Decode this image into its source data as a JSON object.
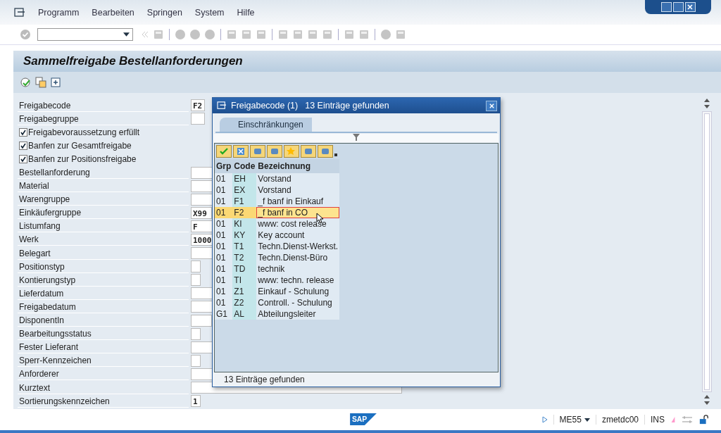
{
  "menu": [
    "Programm",
    "Bearbeiten",
    "Springen",
    "System",
    "Hilfe"
  ],
  "title": "Sammelfreigabe Bestellanforderungen",
  "form": [
    {
      "kind": "field",
      "label": "Freigabecode",
      "value": "F2"
    },
    {
      "kind": "field",
      "label": "Freigabegruppe"
    },
    {
      "kind": "checkbox",
      "label": "Freigabevoraussetzung erfüllt",
      "checked": true
    },
    {
      "kind": "checkbox",
      "label": "Banfen zur Gesamtfreigabe",
      "checked": true
    },
    {
      "kind": "checkbox",
      "label": "Banfen zur Positionsfreigabe",
      "checked": true
    },
    {
      "kind": "field",
      "label": "Bestellanforderung"
    },
    {
      "kind": "field",
      "label": "Material"
    },
    {
      "kind": "field",
      "label": "Warengruppe"
    },
    {
      "kind": "field",
      "label": "Einkäufergruppe",
      "value": "X99"
    },
    {
      "kind": "field",
      "label": "Listumfang",
      "value": "F"
    },
    {
      "kind": "field",
      "label": "Werk",
      "value": "1000"
    },
    {
      "kind": "field",
      "label": "Belegart"
    },
    {
      "kind": "field",
      "label": "Positionstyp"
    },
    {
      "kind": "field",
      "label": "Kontierungstyp"
    },
    {
      "kind": "field",
      "label": "Lieferdatum"
    },
    {
      "kind": "field",
      "label": "Freigabedatum"
    },
    {
      "kind": "field",
      "label": "DisponentIn"
    },
    {
      "kind": "field",
      "label": "Bearbeitungsstatus"
    },
    {
      "kind": "field",
      "label": "Fester Lieferant"
    },
    {
      "kind": "field",
      "label": "Sperr-Kennzeichen"
    },
    {
      "kind": "field",
      "label": "Anforderer"
    },
    {
      "kind": "field",
      "label": "Kurztext"
    },
    {
      "kind": "field",
      "label": "Sortierungskennzeichen",
      "value": "1"
    }
  ],
  "dialog": {
    "title": "Freigabecode (1)",
    "subtitle": "13 Einträge gefunden",
    "tab": "Einschränkungen",
    "columns": [
      "Grp",
      "Code",
      "Bezeichnung"
    ],
    "rows": [
      {
        "cells": [
          "01",
          "EH",
          "Vorstand"
        ],
        "selected": false
      },
      {
        "cells": [
          "01",
          "EX",
          "Vorstand"
        ],
        "selected": false
      },
      {
        "cells": [
          "01",
          "F1",
          "_f banf in Einkauf"
        ],
        "selected": false
      },
      {
        "cells": [
          "01",
          "F2",
          "_f banf in CO"
        ],
        "selected": true
      },
      {
        "cells": [
          "01",
          "KI",
          "www: cost release"
        ],
        "selected": false
      },
      {
        "cells": [
          "01",
          "KY",
          "Key account"
        ],
        "selected": false
      },
      {
        "cells": [
          "01",
          "T1",
          "Techn.Dienst-Werkst."
        ],
        "selected": false
      },
      {
        "cells": [
          "01",
          "T2",
          "Techn.Dienst-Büro"
        ],
        "selected": false
      },
      {
        "cells": [
          "01",
          "TD",
          "technik"
        ],
        "selected": false
      },
      {
        "cells": [
          "01",
          "TI",
          "www: techn. release"
        ],
        "selected": false
      },
      {
        "cells": [
          "01",
          "Z1",
          "Einkauf - Schulung"
        ],
        "selected": false
      },
      {
        "cells": [
          "01",
          "Z2",
          "Controll. - Schulung"
        ],
        "selected": false
      },
      {
        "cells": [
          "G1",
          "AL",
          "Abteilungsleiter"
        ],
        "selected": false
      }
    ],
    "status": "13 Einträge gefunden"
  },
  "status_bar": {
    "logo": "SAP",
    "transaction": "ME55",
    "server": "zmetdc00",
    "mode": "INS"
  }
}
